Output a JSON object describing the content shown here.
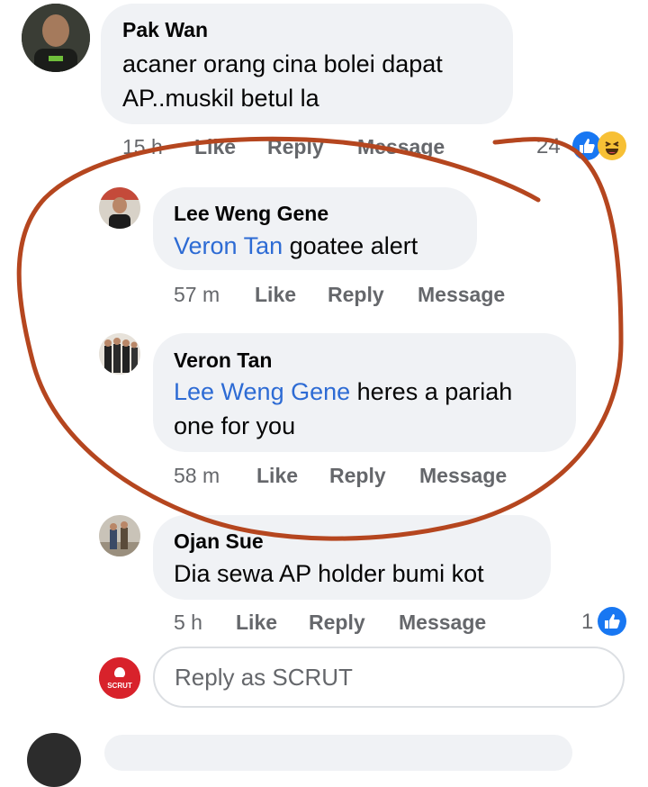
{
  "comments": [
    {
      "author": "Pak Wan",
      "line1": "acaner orang cina bolei dapat",
      "line2": "AP..muskil betul la",
      "time": "15 h",
      "like": "Like",
      "reply": "Reply",
      "message": "Message",
      "reactions": "24"
    },
    {
      "author": "Lee Weng Gene",
      "mention": "Veron Tan",
      "text": " goatee alert",
      "time": "57 m",
      "like": "Like",
      "reply": "Reply",
      "message": "Message"
    },
    {
      "author": "Veron Tan",
      "mention": "Lee Weng Gene",
      "text": " heres a pariah",
      "line2": "one for you",
      "time": "58 m",
      "like": "Like",
      "reply": "Reply",
      "message": "Message"
    },
    {
      "author": "Ojan Sue",
      "text": "Dia sewa AP holder bumi kot",
      "time": "5 h",
      "like": "Like",
      "reply": "Reply",
      "message": "Message",
      "reactions": "1"
    }
  ],
  "reply_box": {
    "placeholder": "Reply as SCRUT",
    "page_logo_text": "SCRUT"
  },
  "colors": {
    "annotation": "#b5461f",
    "mention": "#2d6bd4",
    "like_blue": "#1877f2"
  },
  "icons": [
    "like-reaction-icon",
    "haha-reaction-icon"
  ]
}
